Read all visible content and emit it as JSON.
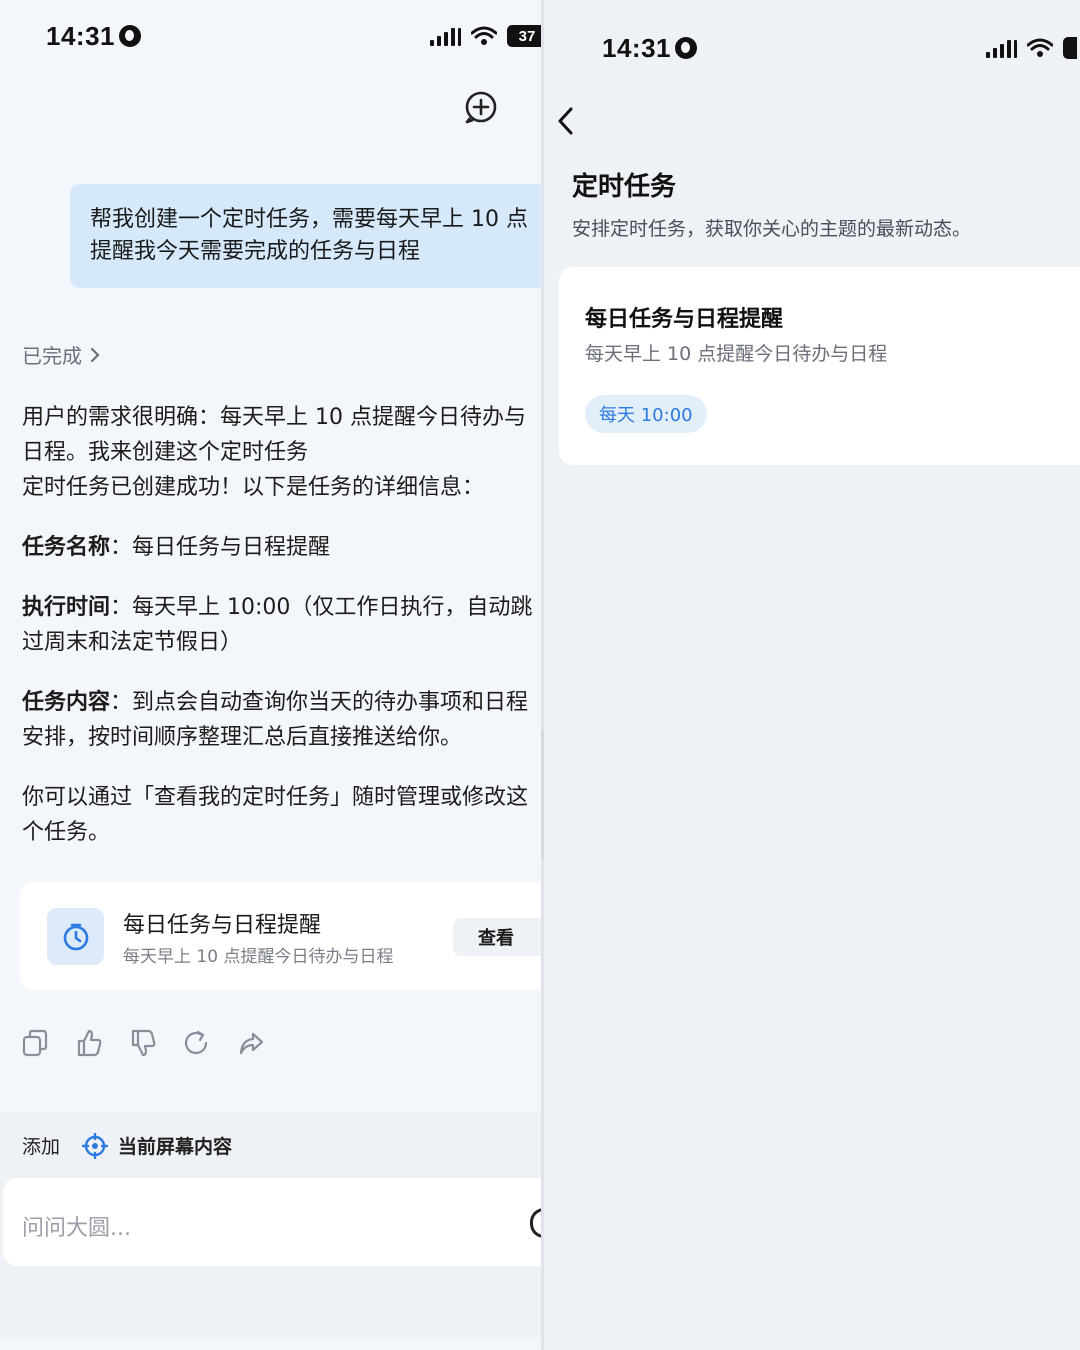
{
  "left_pane": {
    "status_bar": {
      "time": "14:31",
      "battery": "37"
    },
    "new_chat_icon": "plus-circle-icon",
    "user_message": "帮我创建一个定时任务，需要每天早上 10 点提醒我今天需要完成的任务与日程",
    "completed_label": "已完成",
    "response": {
      "intro_line1": "用户的需求很明确：每天早上 10 点提醒今日待办与",
      "intro_line2": "日程。我来创建这个定时任务",
      "intro_line3": "定时任务已创建成功！以下是任务的详细信息：",
      "name_label": "任务名称",
      "name_value": "：每日任务与日程提醒",
      "time_label": "执行时间",
      "time_value_line1": "：每天早上 10:00（仅工作日执行，自动跳",
      "time_value_line2": "过周末和法定节假日）",
      "content_label": "任务内容",
      "content_value_line1": "：到点会自动查询你当天的待办事项和日程",
      "content_value_line2": "安排，按时间顺序整理汇总后直接推送给你。",
      "manage_line1": "你可以通过「查看我的定时任务」随时管理或修改这",
      "manage_line2": "个任务。"
    },
    "task_card": {
      "icon": "timer-icon",
      "title": "每日任务与日程提醒",
      "subtitle": "每天早上 10 点提醒今日待办与日程",
      "button_label": "查看"
    },
    "action_icons": [
      "copy-icon",
      "thumbs-up-icon",
      "thumbs-down-icon",
      "refresh-icon",
      "share-icon"
    ],
    "composer": {
      "add_label": "添加",
      "screen_chip_label": "当前屏幕内容",
      "placeholder": "问问大圆..."
    }
  },
  "right_pane": {
    "status_bar": {
      "time": "14:31"
    },
    "back_icon": "chevron-left-icon",
    "title": "定时任务",
    "subtitle": "安排定时任务，获取你关心的主题的最新动态。",
    "task": {
      "title": "每日任务与日程提醒",
      "subtitle": "每天早上 10 点提醒今日待办与日程",
      "schedule": "每天 10:00"
    }
  },
  "colors": {
    "user_bubble": "#d5e9fb",
    "accent_blue": "#2e7be0",
    "chip_bg": "#e3eefb",
    "panel_bg": "#eef1f6"
  }
}
